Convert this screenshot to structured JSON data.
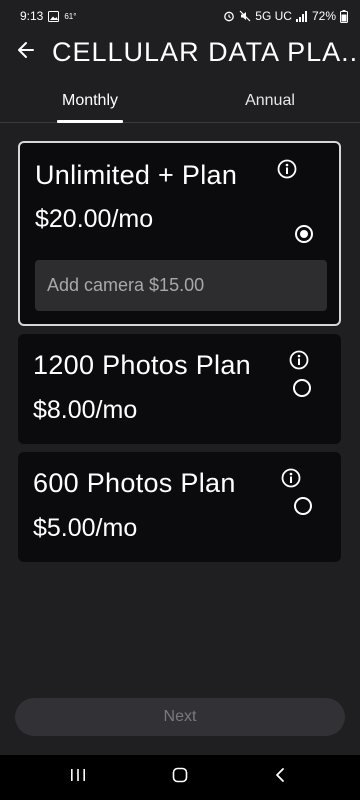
{
  "status_bar": {
    "time": "9:13",
    "temperature": "61°",
    "network": "5G UC",
    "battery": "72%"
  },
  "header": {
    "title": "CELLULAR DATA PLA..."
  },
  "tabs": [
    {
      "label": "Monthly",
      "selected": true
    },
    {
      "label": "Annual",
      "selected": false
    }
  ],
  "plans": [
    {
      "name": "Unlimited + Plan",
      "price": "$20.00/mo",
      "selected": true,
      "addon": "Add camera $15.00"
    },
    {
      "name": "1200 Photos Plan",
      "price": "$8.00/mo",
      "selected": false
    },
    {
      "name": "600 Photos Plan",
      "price": "$5.00/mo",
      "selected": false
    }
  ],
  "next_button": {
    "label": "Next",
    "enabled": false
  },
  "colors": {
    "background": "#1f1f22",
    "card": "#0b0b0d",
    "card_border_selected": "#d6d6d8",
    "addon_bg": "#2d2d30",
    "button_disabled": "#323236",
    "button_text_disabled": "#7a7a7e"
  },
  "icons": {
    "back": "arrow-left-icon",
    "info": "info-circle-icon",
    "nav_recent": "recent-apps-icon",
    "nav_home": "home-icon",
    "nav_back": "chevron-left-icon"
  }
}
